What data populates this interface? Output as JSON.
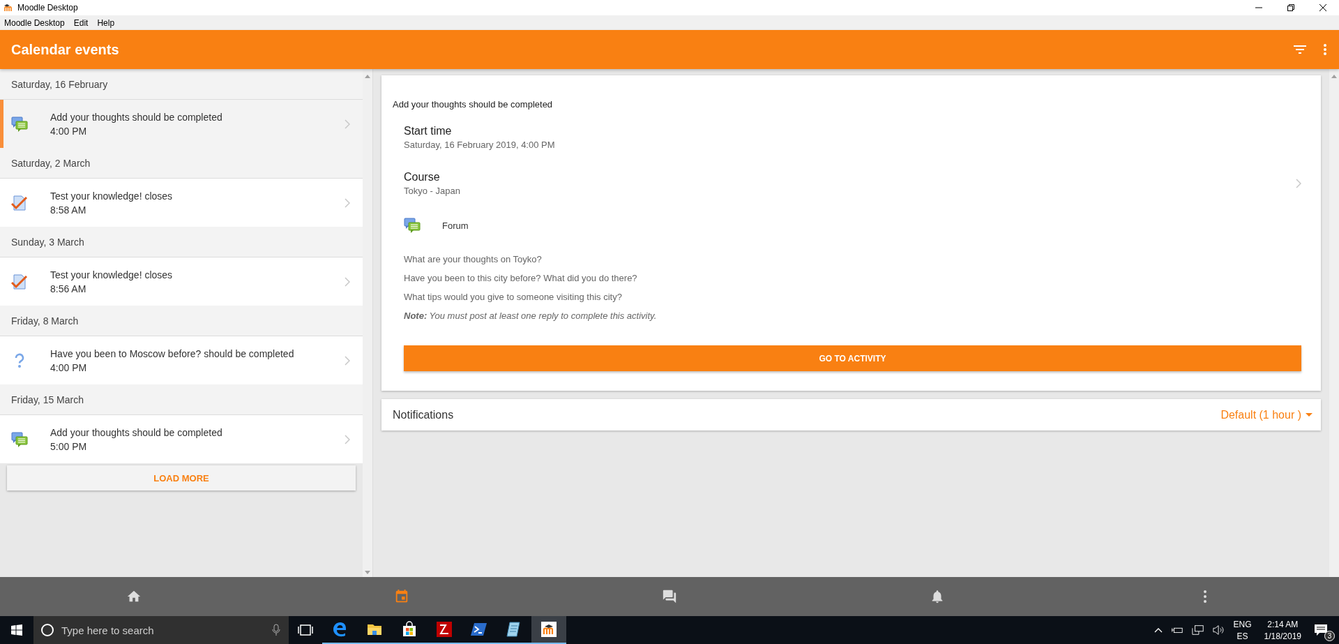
{
  "window": {
    "title": "Moodle Desktop"
  },
  "menu": [
    "Moodle Desktop",
    "Edit",
    "Help"
  ],
  "header": {
    "title": "Calendar events"
  },
  "event_groups": [
    {
      "date": "Saturday, 16 February",
      "items": [
        {
          "kind": "forum",
          "title": "Add your thoughts should be completed",
          "time": "4:00 PM",
          "selected": true
        }
      ]
    },
    {
      "date": "Saturday, 2 March",
      "items": [
        {
          "kind": "quiz",
          "title": "Test your knowledge! closes",
          "time": "8:58 AM",
          "selected": false
        }
      ]
    },
    {
      "date": "Sunday, 3 March",
      "items": [
        {
          "kind": "quiz",
          "title": "Test your knowledge! closes",
          "time": "8:56 AM",
          "selected": false
        }
      ]
    },
    {
      "date": "Friday, 8 March",
      "items": [
        {
          "kind": "question",
          "title": "Have you been to Moscow before? should be completed",
          "time": "4:00 PM",
          "selected": false
        }
      ]
    },
    {
      "date": "Friday, 15 March",
      "items": [
        {
          "kind": "forum",
          "title": "Add your thoughts should be completed",
          "time": "5:00 PM",
          "selected": false
        }
      ]
    }
  ],
  "load_more": "LOAD MORE",
  "detail": {
    "title": "Add your thoughts should be completed",
    "fields": [
      {
        "label": "Start time",
        "value": "Saturday, 16 February 2019, 4:00 PM",
        "link": false
      },
      {
        "label": "Course",
        "value": "Tokyo - Japan",
        "link": true
      }
    ],
    "module": {
      "kind": "forum",
      "label": "Forum"
    },
    "description": [
      "What are your thoughts on Toyko?",
      "Have you been to this city before? What did you do there?",
      "What tips would you give to someone visiting this city?"
    ],
    "note": "**Note:** You must post at least one reply to complete this activity.",
    "button": "GO TO ACTIVITY"
  },
  "notifications": {
    "label": "Notifications",
    "value": "Default (1 hour )"
  },
  "bottom_nav": [
    {
      "kind": "home",
      "selected": false
    },
    {
      "kind": "calendar",
      "selected": true
    },
    {
      "kind": "messages",
      "selected": false
    },
    {
      "kind": "bell",
      "selected": false
    },
    {
      "kind": "more",
      "selected": false
    }
  ],
  "taskbar": {
    "search": {
      "placeholder": "Type here to search"
    },
    "apps": [
      {
        "kind": "edge",
        "selected": false
      },
      {
        "kind": "folder",
        "selected": false
      },
      {
        "kind": "store",
        "selected": false
      },
      {
        "kind": "filezilla",
        "selected": false
      },
      {
        "kind": "powershell",
        "selected": false
      },
      {
        "kind": "notepad",
        "selected": false
      },
      {
        "kind": "moodle",
        "selected": true
      }
    ],
    "language": "ENG",
    "layout": "ES",
    "time": "2:14 AM",
    "date": "1/18/2019",
    "notification_count": "3"
  }
}
